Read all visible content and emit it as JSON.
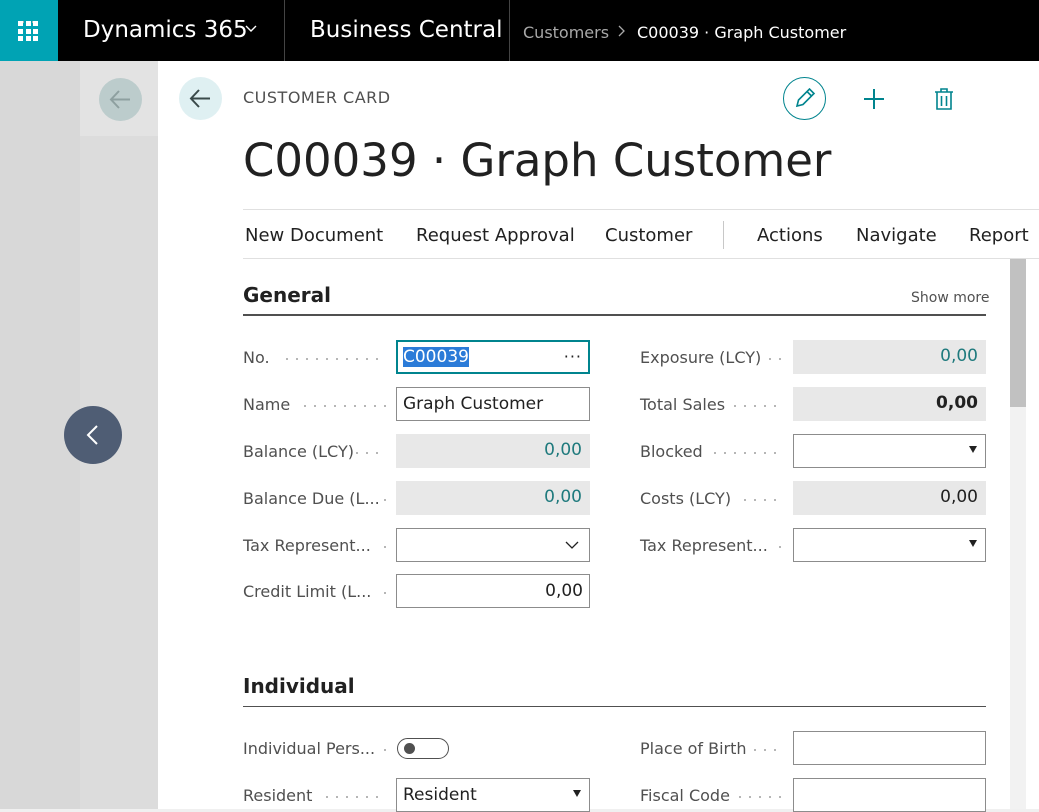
{
  "topbar": {
    "suite": "Dynamics 365",
    "product": "Business Central",
    "breadcrumb": [
      "Customers",
      "C00039 · Graph Customer"
    ]
  },
  "page": {
    "caption": "CUSTOMER CARD",
    "title": "C00039 · Graph Customer"
  },
  "actions": [
    "New Document",
    "Request Approval",
    "Customer",
    "Actions",
    "Navigate",
    "Report"
  ],
  "general": {
    "title": "General",
    "show_more": "Show more",
    "no_label": "No.",
    "no_value": "C00039",
    "name_label": "Name",
    "name_value": "Graph Customer",
    "balance_label": "Balance (LCY)",
    "balance_value": "0,00",
    "balance_due_label": "Balance Due (L...",
    "balance_due_value": "0,00",
    "tax_rep_label": "Tax Represent...",
    "tax_rep_value": "",
    "credit_limit_label": "Credit Limit (L...",
    "credit_limit_value": "0,00",
    "exposure_label": "Exposure (LCY)",
    "exposure_value": "0,00",
    "total_sales_label": "Total Sales",
    "total_sales_value": "0,00",
    "blocked_label": "Blocked",
    "blocked_value": "",
    "costs_label": "Costs (LCY)",
    "costs_value": "0,00",
    "tax_rep2_label": "Tax Represent...",
    "tax_rep2_value": ""
  },
  "individual": {
    "title": "Individual",
    "indiv_person_label": "Individual Pers...",
    "indiv_person_on": false,
    "resident_label": "Resident",
    "resident_value": "Resident",
    "place_of_birth_label": "Place of Birth",
    "place_of_birth_value": "",
    "fiscal_code_label": "Fiscal Code",
    "fiscal_code_value": ""
  },
  "colors": {
    "accent": "#00848e",
    "waffle": "#00a3b4",
    "topbar": "#000000",
    "nav_button": "#4f5d74"
  },
  "icons": {
    "app_launcher": "waffle-icon",
    "back": "arrow-left-icon",
    "edit": "pencil-icon",
    "new": "plus-icon",
    "delete": "trash-icon",
    "previous": "chevron-left-icon"
  }
}
